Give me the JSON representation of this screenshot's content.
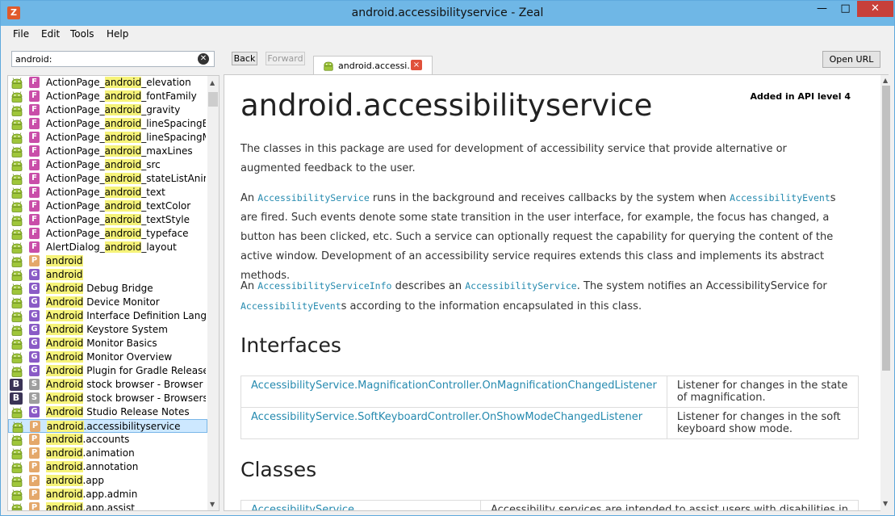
{
  "window": {
    "title": "android.accessibilityservice - Zeal",
    "app_icon": "zeal-app-icon"
  },
  "menu": [
    "File",
    "Edit",
    "Tools",
    "Help"
  ],
  "search": {
    "value": "android:",
    "placeholder": ""
  },
  "toolbar": {
    "back": "Back",
    "forward": "Forward",
    "open_url": "Open URL"
  },
  "tab": {
    "label": "android.accessi...",
    "close": "×"
  },
  "sidebar": {
    "items": [
      {
        "badge": "F",
        "pre": "ActionPage_",
        "hl": "android",
        "post": "_elevation"
      },
      {
        "badge": "F",
        "pre": "ActionPage_",
        "hl": "android",
        "post": "_fontFamily"
      },
      {
        "badge": "F",
        "pre": "ActionPage_",
        "hl": "android",
        "post": "_gravity"
      },
      {
        "badge": "F",
        "pre": "ActionPage_",
        "hl": "android",
        "post": "_lineSpacingEx..."
      },
      {
        "badge": "F",
        "pre": "ActionPage_",
        "hl": "android",
        "post": "_lineSpacingM..."
      },
      {
        "badge": "F",
        "pre": "ActionPage_",
        "hl": "android",
        "post": "_maxLines"
      },
      {
        "badge": "F",
        "pre": "ActionPage_",
        "hl": "android",
        "post": "_src"
      },
      {
        "badge": "F",
        "pre": "ActionPage_",
        "hl": "android",
        "post": "_stateListAnim..."
      },
      {
        "badge": "F",
        "pre": "ActionPage_",
        "hl": "android",
        "post": "_text"
      },
      {
        "badge": "F",
        "pre": "ActionPage_",
        "hl": "android",
        "post": "_textColor"
      },
      {
        "badge": "F",
        "pre": "ActionPage_",
        "hl": "android",
        "post": "_textStyle"
      },
      {
        "badge": "F",
        "pre": "ActionPage_",
        "hl": "android",
        "post": "_typeface"
      },
      {
        "badge": "F",
        "pre": "AlertDialog_",
        "hl": "android",
        "post": "_layout"
      },
      {
        "badge": "P",
        "pre": "",
        "hl": "android",
        "post": ""
      },
      {
        "badge": "G",
        "pre": "",
        "hl": "android",
        "post": ""
      },
      {
        "badge": "G",
        "pre": "",
        "hl": "Android",
        "post": " Debug Bridge"
      },
      {
        "badge": "G",
        "pre": "",
        "hl": "Android",
        "post": " Device Monitor"
      },
      {
        "badge": "G",
        "pre": "",
        "hl": "Android",
        "post": " Interface Definition Langu..."
      },
      {
        "badge": "G",
        "pre": "",
        "hl": "Android",
        "post": " Keystore System"
      },
      {
        "badge": "G",
        "pre": "",
        "hl": "Android",
        "post": " Monitor Basics"
      },
      {
        "badge": "G",
        "pre": "",
        "hl": "Android",
        "post": " Monitor Overview"
      },
      {
        "badge": "G",
        "pre": "",
        "hl": "Android",
        "post": " Plugin for Gradle Release ..."
      },
      {
        "badge": "S",
        "docset": "B",
        "pre": "",
        "hl": "Android",
        "post": " stock browser - Browser a..."
      },
      {
        "badge": "S",
        "docset": "B",
        "pre": "",
        "hl": "Android",
        "post": " stock browser - Browsers a..."
      },
      {
        "badge": "G",
        "pre": "",
        "hl": "Android",
        "post": " Studio Release Notes"
      },
      {
        "badge": "P",
        "pre": "",
        "hl": "android",
        "post": ".accessibilityservice",
        "selected": true
      },
      {
        "badge": "P",
        "pre": "",
        "hl": "android",
        "post": ".accounts"
      },
      {
        "badge": "P",
        "pre": "",
        "hl": "android",
        "post": ".animation"
      },
      {
        "badge": "P",
        "pre": "",
        "hl": "android",
        "post": ".annotation"
      },
      {
        "badge": "P",
        "pre": "",
        "hl": "android",
        "post": ".app"
      },
      {
        "badge": "P",
        "pre": "",
        "hl": "android",
        "post": ".app.admin"
      },
      {
        "badge": "P",
        "pre": "",
        "hl": "android",
        "post": ".app.assist"
      }
    ]
  },
  "content": {
    "added": "Added in API level 4",
    "title": "android.accessibilityservice",
    "p1": "The classes in this package are used for development of accessibility service that provide alternative or augmented feedback to the user.",
    "p2": {
      "a": "An ",
      "c1": "AccessibilityService",
      "b": " runs in the background and receives callbacks by the system when ",
      "c2": "AccessibilityEvent",
      "d": "s are fired. Such events denote some state transition in the user interface, for example, the focus has changed, a button has been clicked, etc. Such a service can optionally request the capability for querying the content of the active window. Development of an accessibility service requires extends this class and implements its abstract methods."
    },
    "p3": {
      "a": "An ",
      "c1": "AccessibilityServiceInfo",
      "b": " describes an ",
      "c2": "AccessibilityService",
      "c": ". The system notifies an AccessibilityService for ",
      "c3": "AccessibilityEvent",
      "d": "s according to the information encapsulated in this class."
    },
    "interfaces_heading": "Interfaces",
    "interfaces": [
      {
        "name": "AccessibilityService.MagnificationController.OnMagnificationChangedListener",
        "desc": "Listener for changes in the state of magnification."
      },
      {
        "name": "AccessibilityService.SoftKeyboardController.OnShowModeChangedListener",
        "desc": "Listener for changes in the soft keyboard show mode."
      }
    ],
    "classes_heading": "Classes",
    "classes": [
      {
        "name": "AccessibilityService",
        "desc": "Accessibility services are intended to assist users with disabilities in"
      }
    ]
  }
}
